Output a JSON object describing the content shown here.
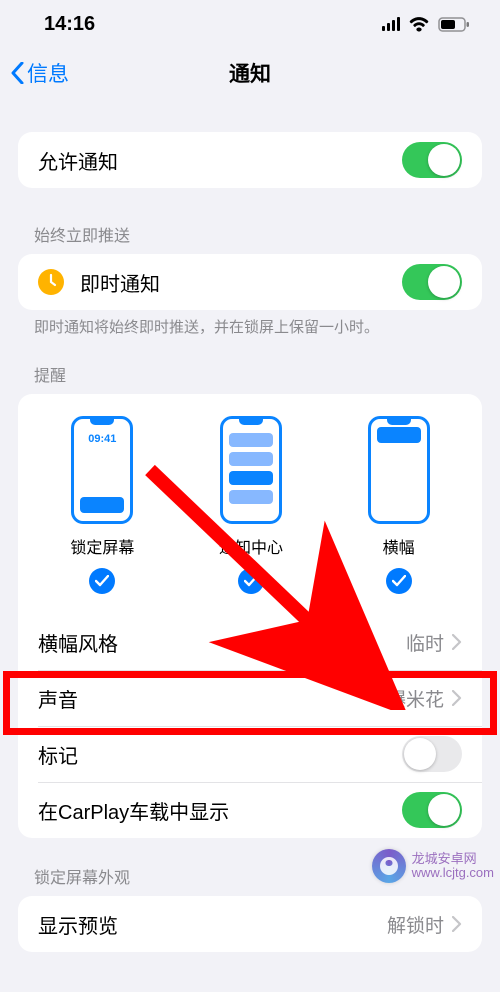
{
  "status": {
    "time": "14:16"
  },
  "nav": {
    "back": "信息",
    "title": "通知"
  },
  "allow": {
    "label": "允许通知",
    "on": true
  },
  "instant": {
    "header": "始终立即推送",
    "label": "即时通知",
    "on": true,
    "footer": "即时通知将始终即时推送，并在锁屏上保留一小时。"
  },
  "alerts": {
    "header": "提醒",
    "lock_time": "09:41",
    "options": [
      {
        "label": "锁定屏幕",
        "checked": true
      },
      {
        "label": "通知中心",
        "checked": true
      },
      {
        "label": "横幅",
        "checked": true
      }
    ],
    "banner_style": {
      "label": "横幅风格",
      "value": "临时"
    },
    "sounds": {
      "label": "声音",
      "value": "爆米花"
    },
    "badges": {
      "label": "标记",
      "on": false
    },
    "carplay": {
      "label": "在CarPlay车载中显示",
      "on": true
    }
  },
  "lockscreen": {
    "header": "锁定屏幕外观",
    "preview": {
      "label": "显示预览",
      "value": "解锁时"
    }
  },
  "watermark": {
    "line1": "龙城安卓网",
    "line2": "www.lcjtg.com"
  }
}
